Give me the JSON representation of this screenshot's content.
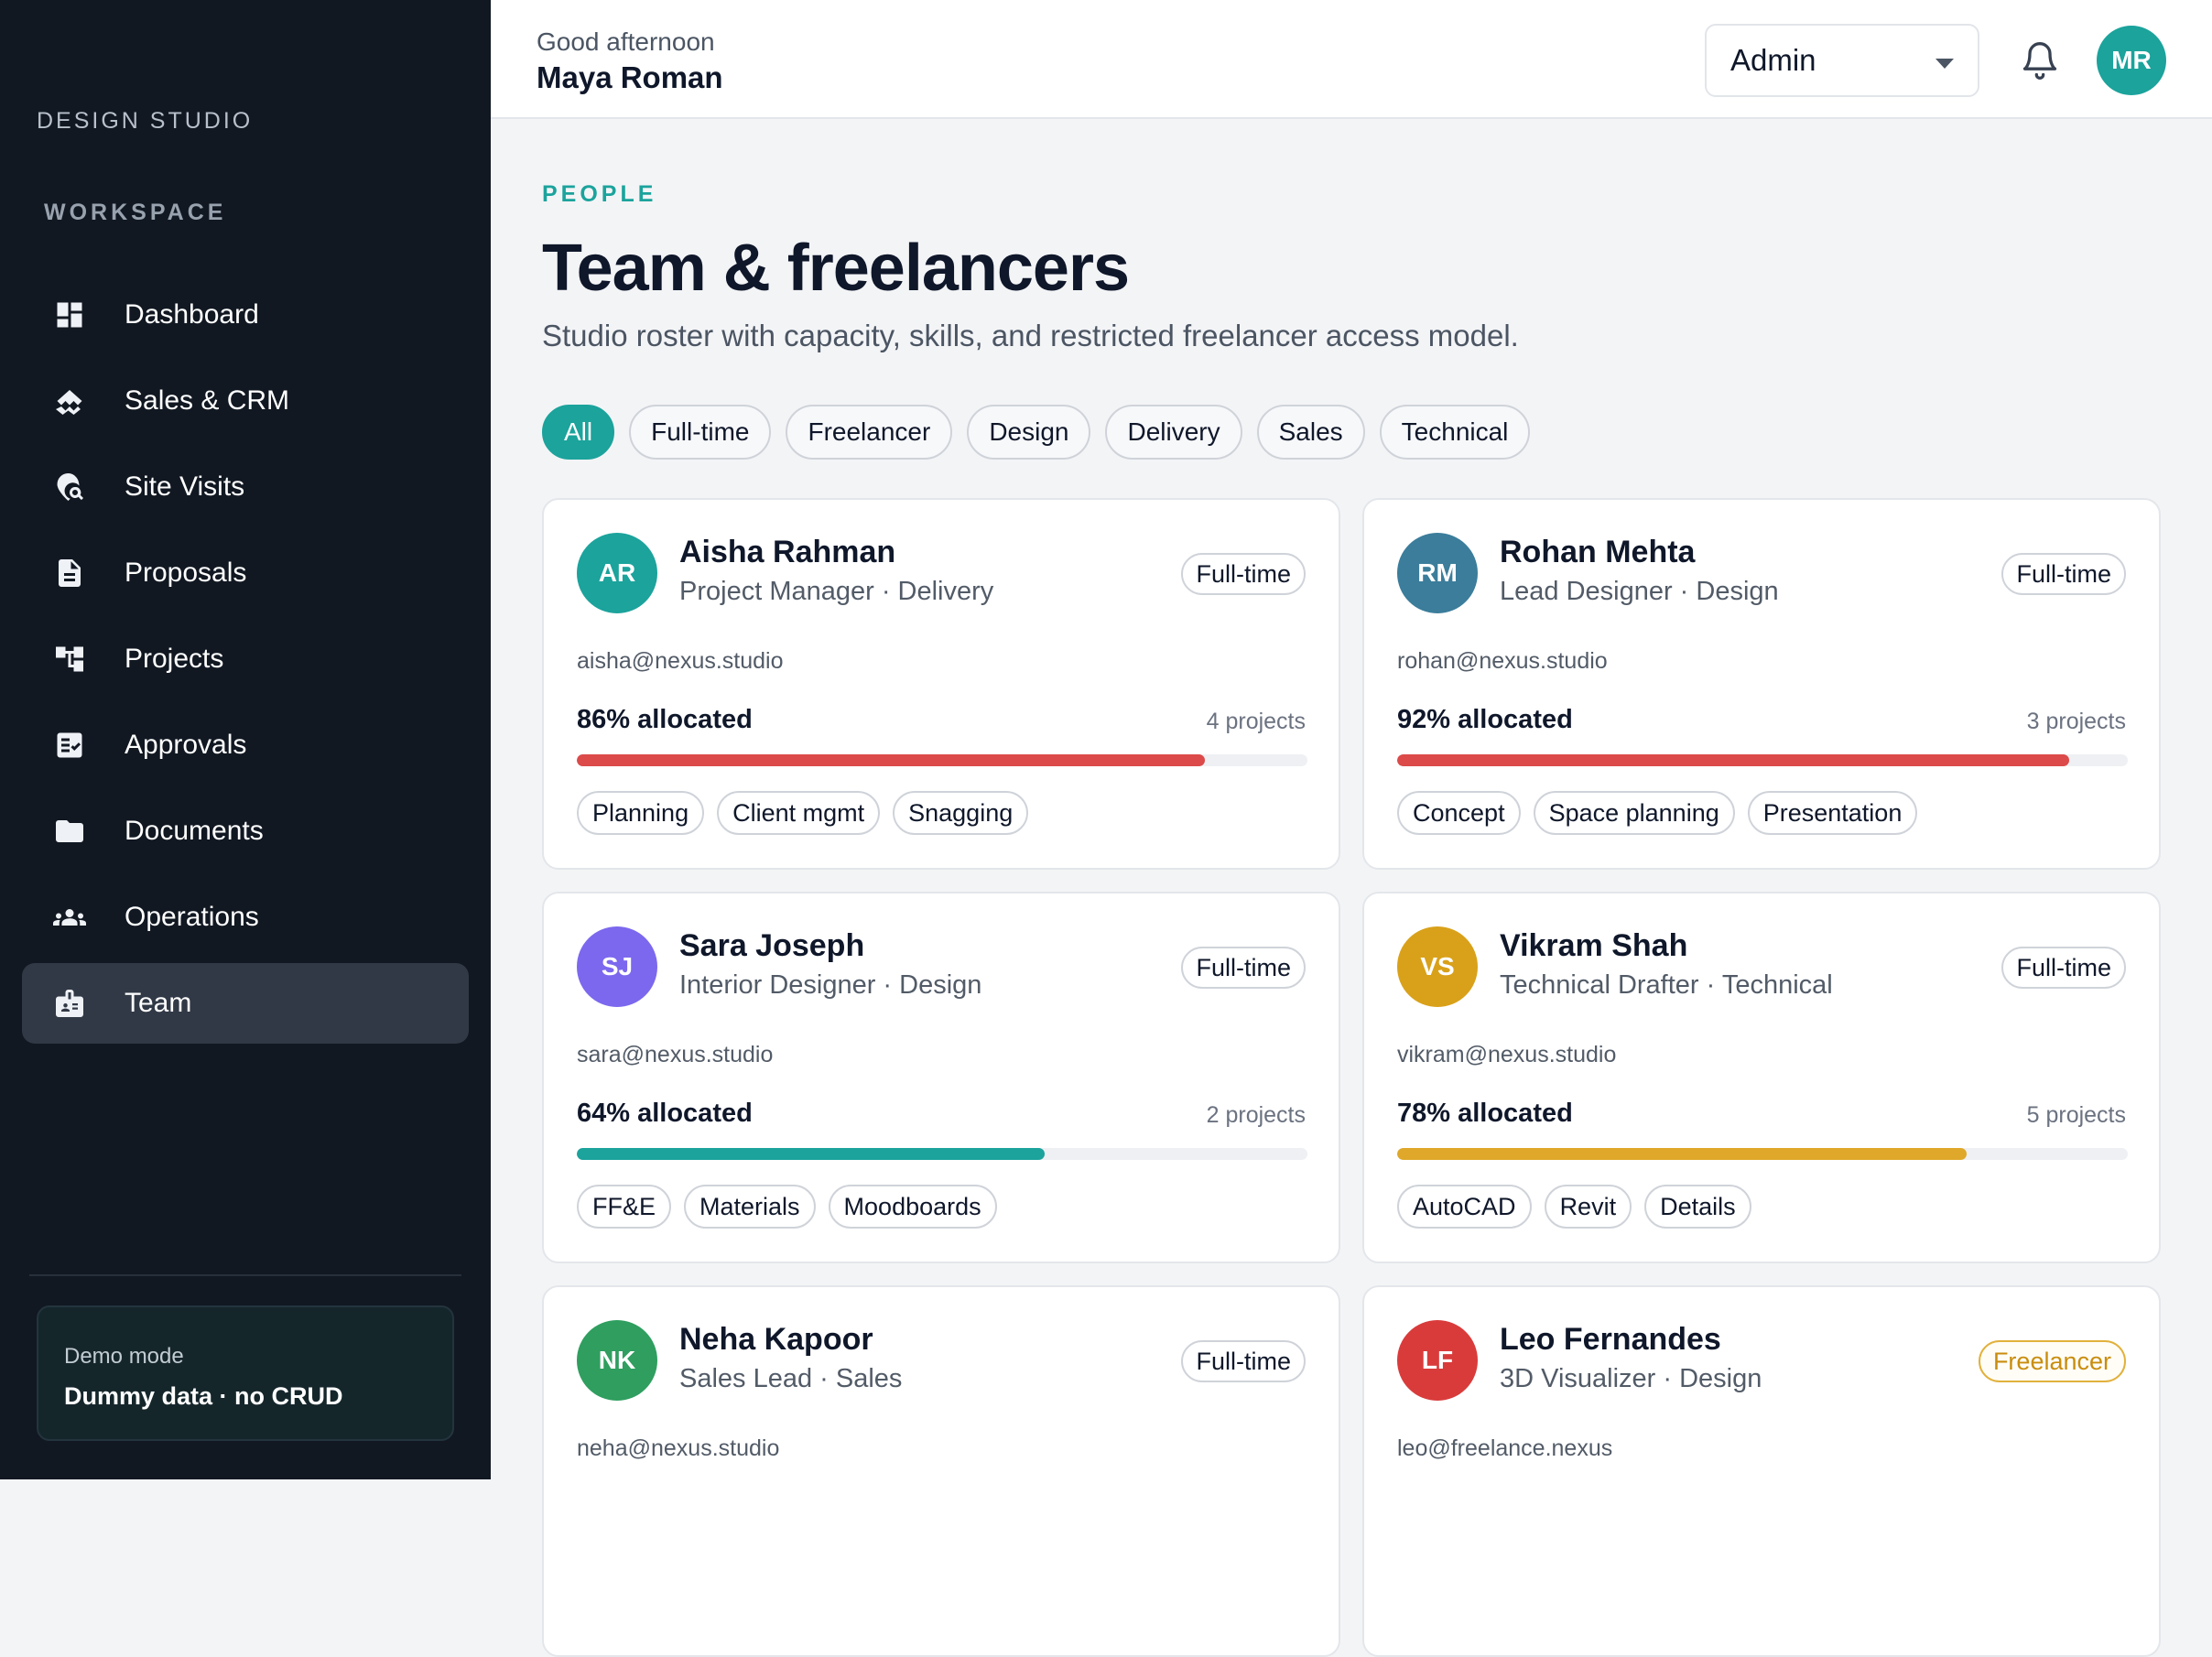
{
  "sidebar": {
    "brand": "DESIGN STUDIO",
    "section": "WORKSPACE",
    "items": [
      {
        "label": "Dashboard",
        "icon": "dashboard-icon"
      },
      {
        "label": "Sales & CRM",
        "icon": "handshake-icon"
      },
      {
        "label": "Site Visits",
        "icon": "location-search-icon"
      },
      {
        "label": "Proposals",
        "icon": "document-icon"
      },
      {
        "label": "Projects",
        "icon": "tree-structure-icon"
      },
      {
        "label": "Approvals",
        "icon": "checklist-icon"
      },
      {
        "label": "Documents",
        "icon": "folder-icon"
      },
      {
        "label": "Operations",
        "icon": "group-icon"
      },
      {
        "label": "Team",
        "icon": "badge-icon",
        "active": true
      }
    ],
    "demo": {
      "label": "Demo mode",
      "value": "Dummy data · no CRUD"
    }
  },
  "header": {
    "greeting": "Good afternoon",
    "user_name": "Maya Roman",
    "role_select": "Admin",
    "avatar_initials": "MR"
  },
  "main": {
    "eyebrow": "PEOPLE",
    "title": "Team & freelancers",
    "subtitle": "Studio roster with capacity, skills, and restricted freelancer access model.",
    "filters": [
      "All",
      "Full-time",
      "Freelancer",
      "Design",
      "Delivery",
      "Sales",
      "Technical"
    ],
    "active_filter": "All",
    "members": [
      {
        "initials": "AR",
        "avatar_color": "#1ba39c",
        "name": "Aisha Rahman",
        "role": "Project Manager · Delivery",
        "type": "Full-time",
        "email": "aisha@nexus.studio",
        "allocation_label": "86% allocated",
        "allocation": 86,
        "bar_color": "#dc4a4a",
        "projects": "4 projects",
        "skills": [
          "Planning",
          "Client mgmt",
          "Snagging"
        ]
      },
      {
        "initials": "RM",
        "avatar_color": "#3b7d9b",
        "name": "Rohan Mehta",
        "role": "Lead Designer · Design",
        "type": "Full-time",
        "email": "rohan@nexus.studio",
        "allocation_label": "92% allocated",
        "allocation": 92,
        "bar_color": "#dc4a4a",
        "projects": "3 projects",
        "skills": [
          "Concept",
          "Space planning",
          "Presentation"
        ]
      },
      {
        "initials": "SJ",
        "avatar_color": "#7b68ee",
        "name": "Sara Joseph",
        "role": "Interior Designer · Design",
        "type": "Full-time",
        "email": "sara@nexus.studio",
        "allocation_label": "64% allocated",
        "allocation": 64,
        "bar_color": "#1ba39c",
        "projects": "2 projects",
        "skills": [
          "FF&E",
          "Materials",
          "Moodboards"
        ]
      },
      {
        "initials": "VS",
        "avatar_color": "#d9a11a",
        "name": "Vikram Shah",
        "role": "Technical Drafter · Technical",
        "type": "Full-time",
        "email": "vikram@nexus.studio",
        "allocation_label": "78% allocated",
        "allocation": 78,
        "bar_color": "#dfa82a",
        "projects": "5 projects",
        "skills": [
          "AutoCAD",
          "Revit",
          "Details"
        ]
      },
      {
        "initials": "NK",
        "avatar_color": "#2f9e5f",
        "name": "Neha Kapoor",
        "role": "Sales Lead · Sales",
        "type": "Full-time",
        "email": "neha@nexus.studio",
        "allocation_label": "",
        "allocation": null,
        "bar_color": "#1ba39c",
        "projects": "",
        "skills": []
      },
      {
        "initials": "LF",
        "avatar_color": "#d93b3b",
        "name": "Leo Fernandes",
        "role": "3D Visualizer · Design",
        "type": "Freelancer",
        "email": "leo@freelance.nexus",
        "allocation_label": "",
        "allocation": null,
        "bar_color": "#1ba39c",
        "projects": "",
        "skills": []
      }
    ]
  }
}
